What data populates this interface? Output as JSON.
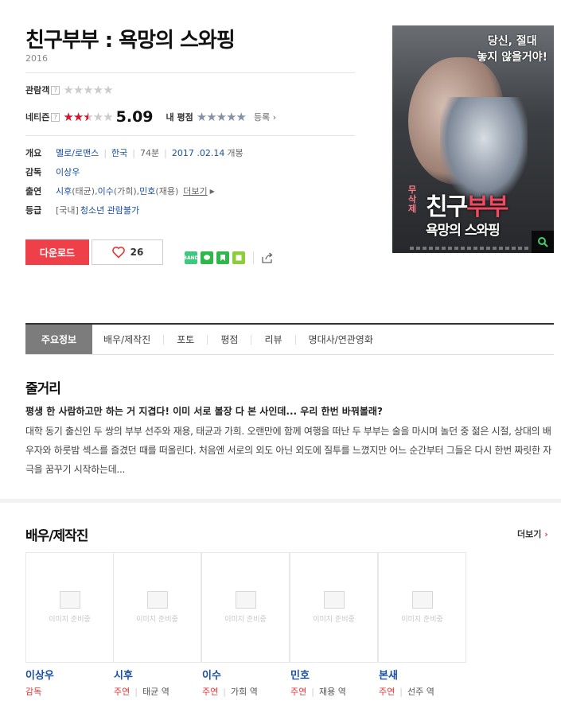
{
  "movie": {
    "title": "친구부부 : 욕망의 스와핑",
    "year": "2016"
  },
  "ratings": {
    "audience_label": "관람객",
    "netizen_label": "네티즌",
    "netizen_score": "5.09",
    "netizen_score_value": 5.09,
    "my_rating_label": "내 평점",
    "register_label": "등록",
    "help_mark": "?"
  },
  "info": {
    "overview_label": "개요",
    "genre": "멜로/로맨스",
    "country": "한국",
    "runtime": "74분",
    "release": "2017 .02.14",
    "release_suffix": "개봉",
    "director_label": "감독",
    "director": "이상우",
    "cast_label": "출연",
    "cast": [
      {
        "name": "시후",
        "role": "(태균)"
      },
      {
        "name": "이수",
        "role": "(가희)"
      },
      {
        "name": "민호",
        "role": "(재용)"
      }
    ],
    "cast_more": "더보기",
    "grade_label": "등급",
    "grade_prefix": "[국내]",
    "grade": "청소년 관람불가"
  },
  "actions": {
    "download": "다운로드",
    "like_count": "26"
  },
  "share": {
    "items": [
      {
        "name": "band",
        "text": "BAND",
        "color": "#3fc67f"
      },
      {
        "name": "line",
        "text": "",
        "color": "#2fb84a"
      },
      {
        "name": "bookmark",
        "text": "",
        "color": "#2fb84a"
      },
      {
        "name": "square",
        "text": "",
        "color": "#8ccd3a"
      }
    ]
  },
  "poster": {
    "tagline_line1": "당신, 절대",
    "tagline_line2": "놓지 않을거야!",
    "uncut": "무삭제",
    "title_white": "친구",
    "title_pink": "부부",
    "subtitle": "욕망의 스와핑"
  },
  "tabs": [
    "주요정보",
    "배우/제작진",
    "포토",
    "평점",
    "리뷰",
    "명대사/연관영화"
  ],
  "synopsis": {
    "heading": "줄거리",
    "tagline": "평생 한 사람하고만 하는 거 지겹다! 이미 서로 볼장 다 본 사인데... 우리 한번 바꿔볼래?",
    "body": "대학 동기 출신인 두 쌍의 부부 선주와 재용, 태균과 가희. 오랜만에 함께 여행을 떠난 두 부부는 술을 마시며 놀던 중 젊은 시절, 상대의 배우자와 하룻밤 섹스를 즐겼던 때를 떠올린다. 처음엔 서로의 외도 아닌 외도에 질투를 느꼈지만 어느 순간부터 그들은 다시 한번 짜릿한 자극을 꿈꾸기 시작하는데..."
  },
  "cast_section": {
    "heading": "배우/제작진",
    "more": "더보기",
    "placeholder": "이미지 준비중",
    "people": [
      {
        "name": "이상우",
        "role": "감독",
        "character": ""
      },
      {
        "name": "시후",
        "role": "주연",
        "character": "태균 역"
      },
      {
        "name": "이수",
        "role": "주연",
        "character": "가희 역"
      },
      {
        "name": "민호",
        "role": "주연",
        "character": "재용 역"
      },
      {
        "name": "본새",
        "role": "주연",
        "character": "선주 역"
      }
    ]
  }
}
